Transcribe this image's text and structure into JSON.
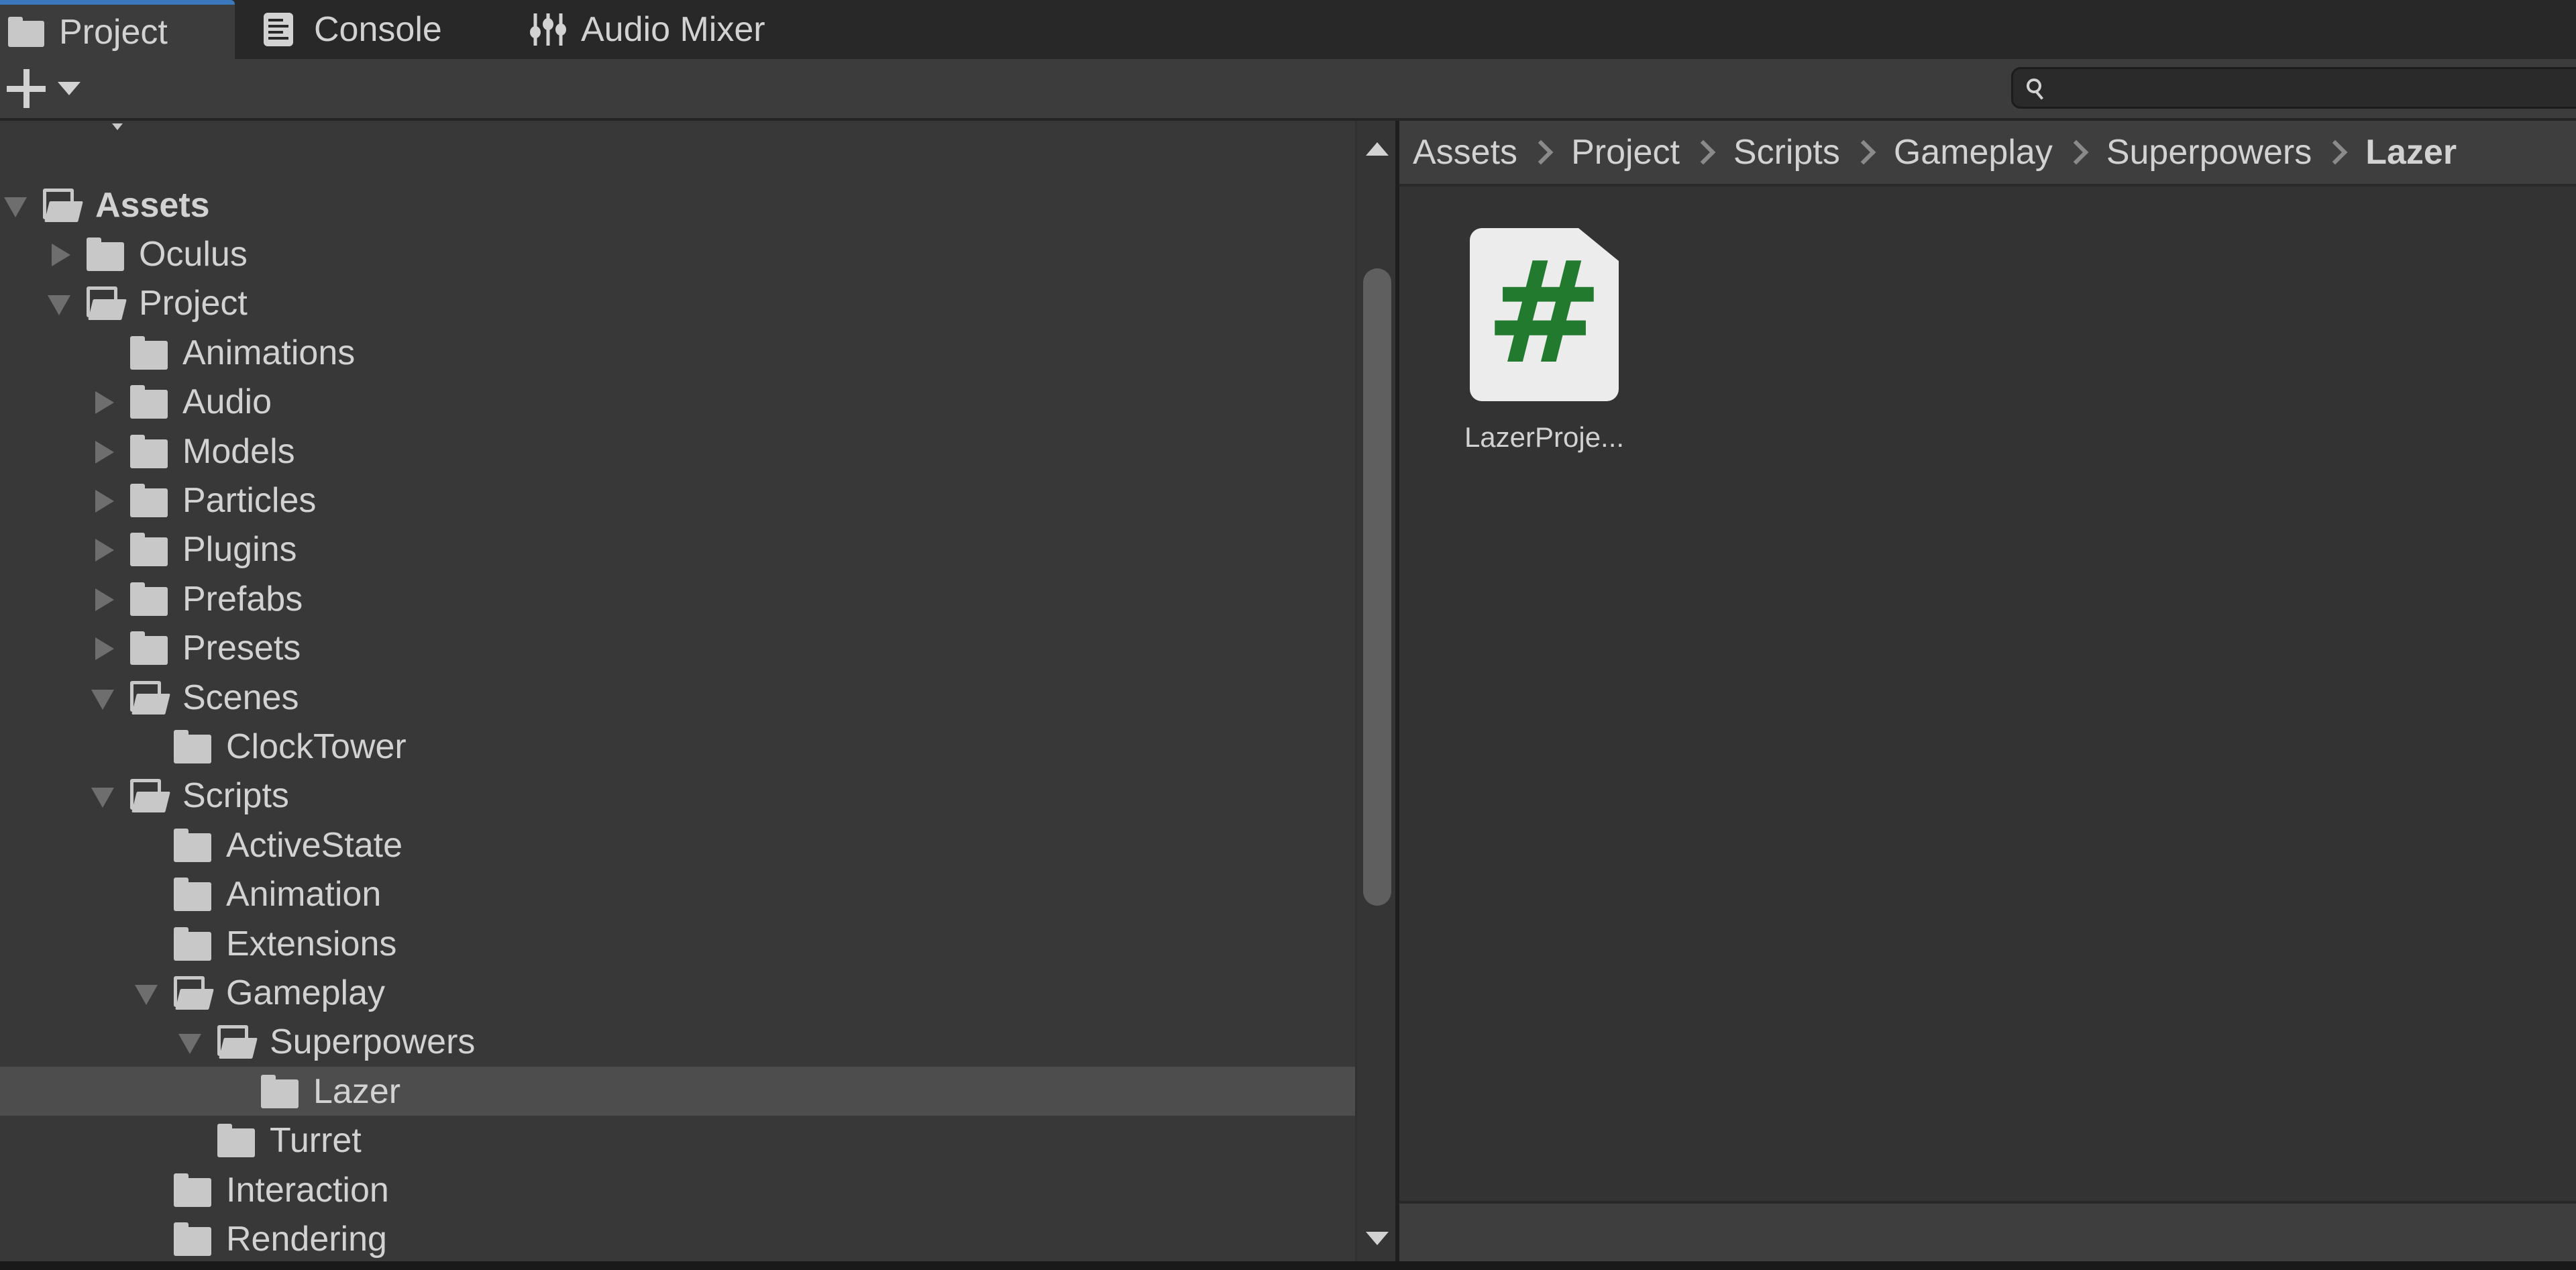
{
  "tabs": [
    {
      "label": "Project",
      "icon": "folder-icon",
      "active": true
    },
    {
      "label": "Console",
      "icon": "console-icon",
      "active": false
    },
    {
      "label": "Audio Mixer",
      "icon": "audio-mixer-icon",
      "active": false
    }
  ],
  "toolbar": {
    "add_icon": "plus-icon",
    "add_dropdown_icon": "caret-down-icon",
    "search": {
      "value": "",
      "placeholder": "",
      "icon": "search-icon"
    }
  },
  "tree": [
    {
      "label": "Assets",
      "level": 0,
      "state": "expanded",
      "bold": true
    },
    {
      "label": "Oculus",
      "level": 1,
      "state": "collapsed"
    },
    {
      "label": "Project",
      "level": 1,
      "state": "expanded"
    },
    {
      "label": "Animations",
      "level": 2,
      "state": "leaf"
    },
    {
      "label": "Audio",
      "level": 2,
      "state": "collapsed"
    },
    {
      "label": "Models",
      "level": 2,
      "state": "collapsed"
    },
    {
      "label": "Particles",
      "level": 2,
      "state": "collapsed"
    },
    {
      "label": "Plugins",
      "level": 2,
      "state": "collapsed"
    },
    {
      "label": "Prefabs",
      "level": 2,
      "state": "collapsed"
    },
    {
      "label": "Presets",
      "level": 2,
      "state": "collapsed"
    },
    {
      "label": "Scenes",
      "level": 2,
      "state": "expanded"
    },
    {
      "label": "ClockTower",
      "level": 3,
      "state": "leaf"
    },
    {
      "label": "Scripts",
      "level": 2,
      "state": "expanded"
    },
    {
      "label": "ActiveState",
      "level": 3,
      "state": "leaf"
    },
    {
      "label": "Animation",
      "level": 3,
      "state": "leaf"
    },
    {
      "label": "Extensions",
      "level": 3,
      "state": "leaf"
    },
    {
      "label": "Gameplay",
      "level": 3,
      "state": "expanded"
    },
    {
      "label": "Superpowers",
      "level": 4,
      "state": "expanded"
    },
    {
      "label": "Lazer",
      "level": 5,
      "state": "leaf",
      "selected": true
    },
    {
      "label": "Turret",
      "level": 4,
      "state": "leaf"
    },
    {
      "label": "Interaction",
      "level": 3,
      "state": "leaf"
    },
    {
      "label": "Rendering",
      "level": 3,
      "state": "leaf"
    }
  ],
  "breadcrumb": [
    "Assets",
    "Project",
    "Scripts",
    "Gameplay",
    "Superpowers",
    "Lazer"
  ],
  "assets": [
    {
      "label": "LazerProje...",
      "type": "csharp-script",
      "icon": "csharp-script-icon",
      "glyph": "#"
    }
  ],
  "colors": {
    "accent": "#3a79bb",
    "script_icon_green": "#217a2d",
    "panel_bg": "#383838",
    "selected_row": "#4d4d4d"
  }
}
